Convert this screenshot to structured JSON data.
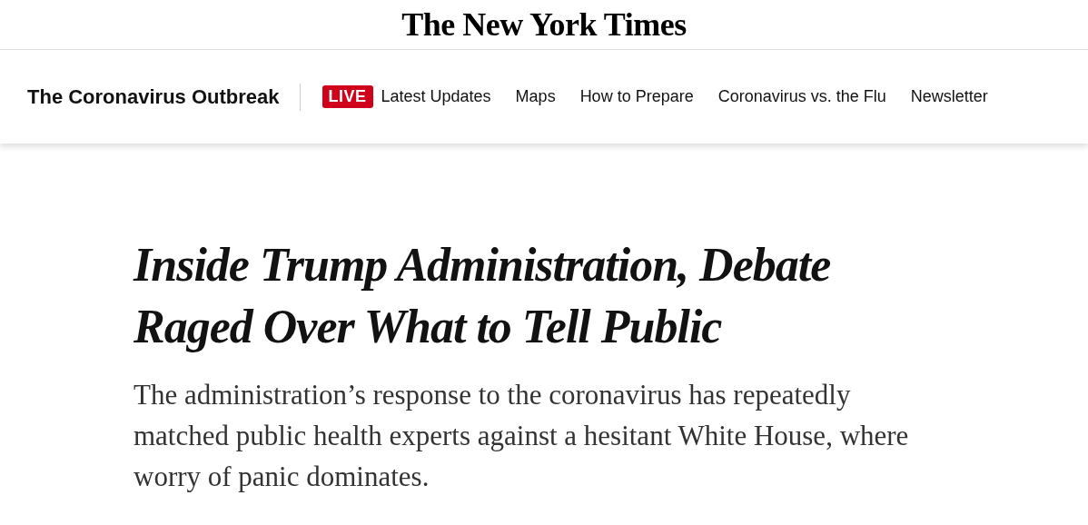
{
  "masthead": {
    "logo": "The New York Times"
  },
  "section_nav": {
    "title": "The Coronavirus Outbreak",
    "links": [
      {
        "kind": "live",
        "badge": "LIVE",
        "label": "Latest Updates"
      },
      {
        "kind": "plain",
        "label": "Maps"
      },
      {
        "kind": "plain",
        "label": "How to Prepare"
      },
      {
        "kind": "plain",
        "label": "Coronavirus vs. the Flu"
      },
      {
        "kind": "plain",
        "label": "Newsletter"
      }
    ]
  },
  "article": {
    "headline": "Inside Trump Administration, Debate Raged Over What to Tell Public",
    "summary": "The administration’s response to the coronavirus has repeatedly matched public health experts against a hesitant White House, where worry of panic dominates."
  }
}
